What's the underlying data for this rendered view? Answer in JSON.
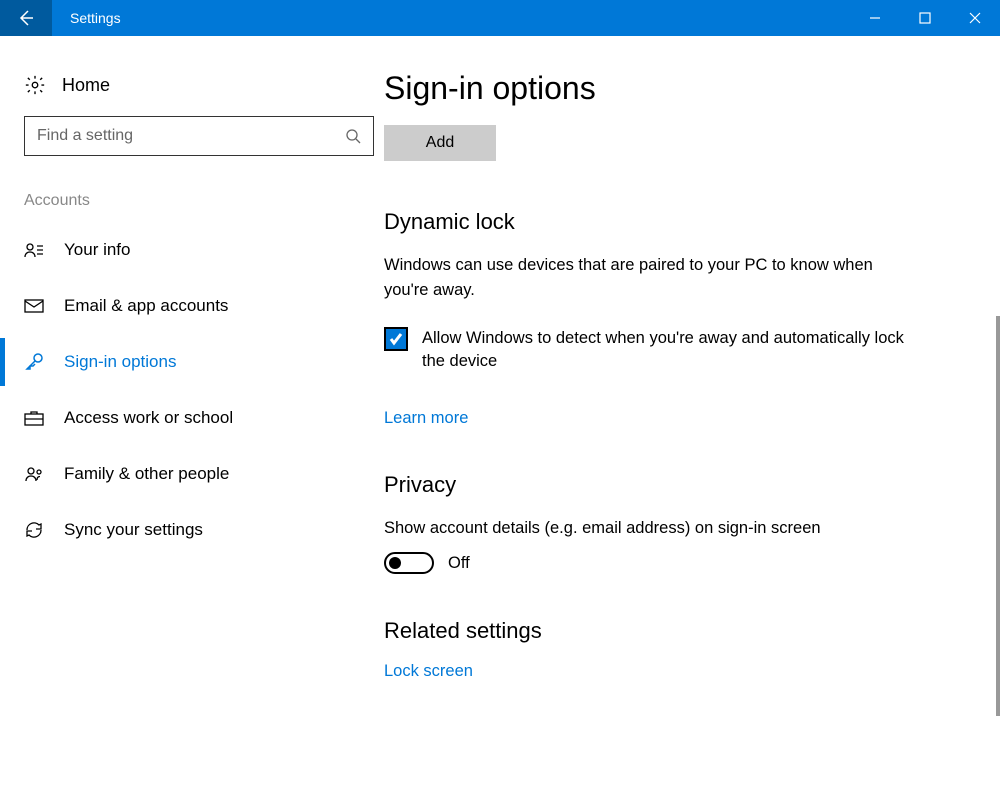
{
  "titlebar": {
    "title": "Settings"
  },
  "sidebar": {
    "home_label": "Home",
    "search_placeholder": "Find a setting",
    "section_label": "Accounts",
    "items": [
      {
        "label": "Your info"
      },
      {
        "label": "Email & app accounts"
      },
      {
        "label": "Sign-in options"
      },
      {
        "label": "Access work or school"
      },
      {
        "label": "Family & other people"
      },
      {
        "label": "Sync your settings"
      }
    ]
  },
  "content": {
    "page_title": "Sign-in options",
    "add_label": "Add",
    "dynamic_lock": {
      "title": "Dynamic lock",
      "description": "Windows can use devices that are paired to your PC to know when you're away.",
      "checkbox_label": "Allow Windows to detect when you're away and automatically lock the device",
      "checkbox_checked": true,
      "learn_more": "Learn more"
    },
    "privacy": {
      "title": "Privacy",
      "description": "Show account details (e.g. email address) on sign-in screen",
      "toggle_state": "Off",
      "toggle_on": false
    },
    "related": {
      "title": "Related settings",
      "lock_screen": "Lock screen"
    }
  }
}
